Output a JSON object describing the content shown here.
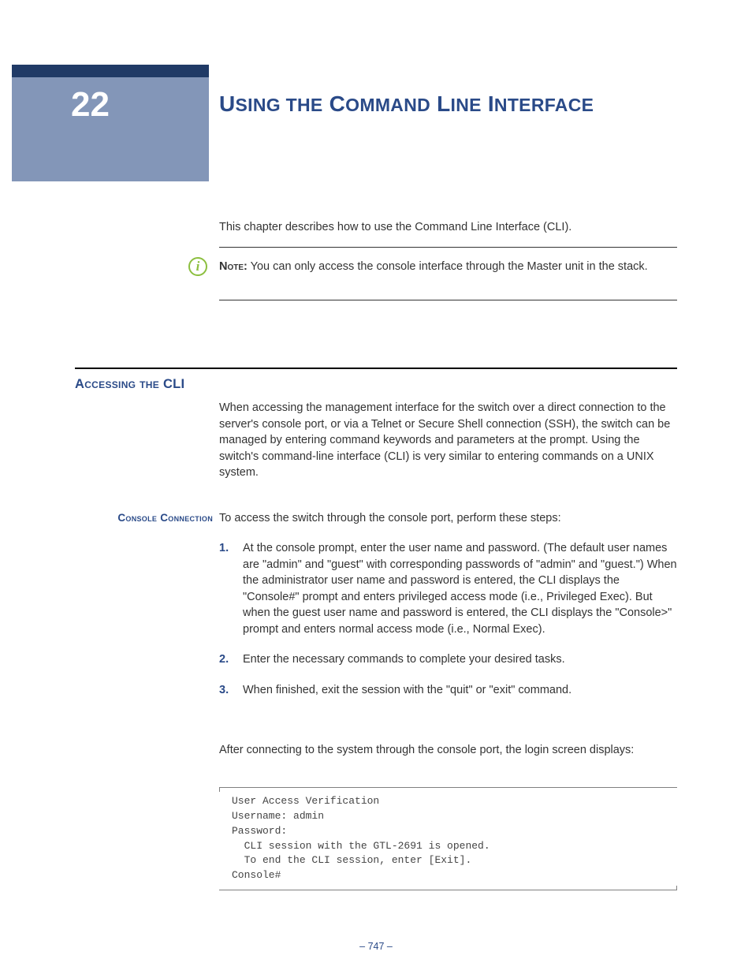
{
  "chapter": {
    "number": "22",
    "title_html": "U<span style='font-size:23px'>SING THE</span> C<span style='font-size:23px'>OMMAND</span> L<span style='font-size:23px'>INE</span> I<span style='font-size:23px'>NTERFACE</span>"
  },
  "intro": "This chapter describes how to use the Command Line Interface (CLI).",
  "note": {
    "label": "Note:",
    "text": " You can only access the console interface through the Master unit in the stack.",
    "icon_glyph": "i"
  },
  "section": {
    "heading": "Accessing the CLI",
    "body": "When accessing the management interface for the switch over a direct connection to the server's console port, or via a Telnet or Secure Shell connection (SSH), the switch can be managed by entering command keywords and parameters at the prompt. Using the switch's command-line interface (CLI) is very similar to entering commands on a UNIX system."
  },
  "subsection": {
    "side_heading": "Console Connection",
    "intro": "To access the switch through the console port, perform these steps:",
    "steps": [
      "At the console prompt, enter the user name and password. (The default user names are \"admin\" and \"guest\" with corresponding passwords of \"admin\" and \"guest.\") When the administrator user name and password is entered, the CLI displays the \"Console#\" prompt and enters privileged access mode (i.e., Privileged Exec). But when the guest user name and password is entered, the CLI displays the \"Console>\" prompt and enters normal access mode (i.e., Normal Exec).",
      "Enter the necessary commands to complete your desired tasks.",
      "When finished, exit the session with the \"quit\" or \"exit\" command."
    ],
    "after": "After connecting to the system through the console port, the login screen displays:",
    "code": "User Access Verification\nUsername: admin\nPassword:\n  CLI session with the GTL-2691 is opened.\n  To end the CLI session, enter [Exit].\nConsole#"
  },
  "page_number": "–  747  –"
}
